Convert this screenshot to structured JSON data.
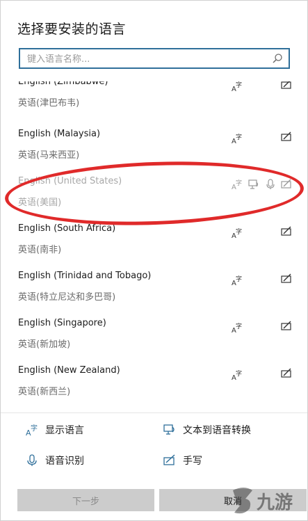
{
  "dialog": {
    "title": "选择要安装的语言",
    "search_placeholder": "键入语言名称..."
  },
  "languages": [
    {
      "name": "English (Zimbabwe)",
      "native": "英语(津巴布韦)",
      "features": [
        "display-language-icon",
        "handwriting-icon"
      ]
    },
    {
      "name": "English (Malaysia)",
      "native": "英语(马来西亚)",
      "features": [
        "display-language-icon",
        "handwriting-icon"
      ]
    },
    {
      "name": "English (United States)",
      "native": "英语(美国)",
      "features": [
        "display-language-icon",
        "text-to-speech-icon",
        "speech-recognition-icon",
        "handwriting-icon"
      ],
      "state": "highlighted"
    },
    {
      "name": "English (South Africa)",
      "native": "英语(南非)",
      "features": [
        "display-language-icon",
        "handwriting-icon"
      ]
    },
    {
      "name": "English (Trinidad and Tobago)",
      "native": "英语(特立尼达和多巴哥)",
      "features": [
        "display-language-icon",
        "handwriting-icon"
      ]
    },
    {
      "name": "English (Singapore)",
      "native": "英语(新加坡)",
      "features": [
        "display-language-icon",
        "handwriting-icon"
      ]
    },
    {
      "name": "English (New Zealand)",
      "native": "英语(新西兰)",
      "features": [
        "display-language-icon",
        "handwriting-icon"
      ]
    }
  ],
  "legend": {
    "display_language": "显示语言",
    "text_to_speech": "文本到语音转换",
    "speech_recognition": "语音识别",
    "handwriting": "手写"
  },
  "buttons": {
    "next": "下一步",
    "cancel": "取消"
  },
  "watermark": {
    "text": "九游"
  },
  "colors": {
    "accent": "#2f6f9a",
    "annotation_red": "#e02a2a",
    "button_gray": "#cccccc"
  }
}
